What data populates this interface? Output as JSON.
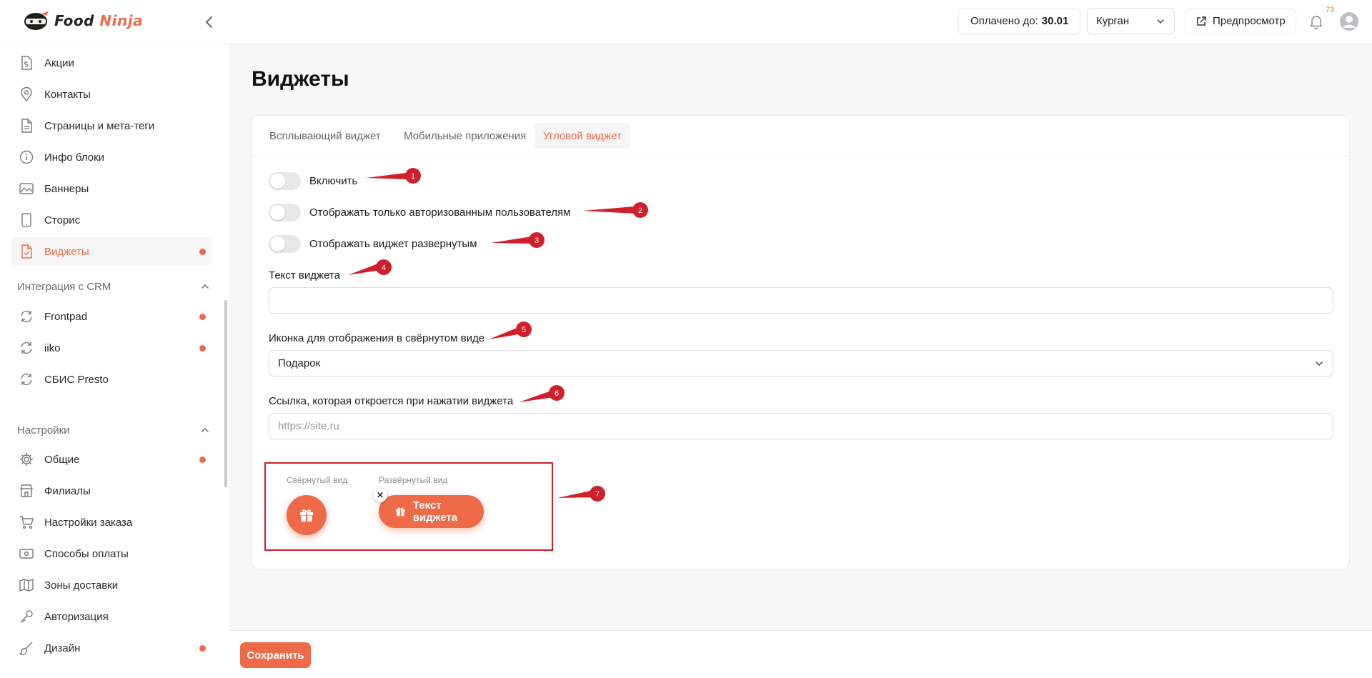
{
  "app": {
    "logo_word1": "Food",
    "logo_word2": "Ninja"
  },
  "header": {
    "paid_label": "Оплачено до:",
    "paid_date": "30.01",
    "city": "Курган",
    "preview_label": "Предпросмотр",
    "notification_count": "73"
  },
  "sidebar": {
    "items": [
      {
        "label": "Акции",
        "icon": "dollar-doc-icon",
        "dot": false,
        "active": false
      },
      {
        "label": "Контакты",
        "icon": "map-pin-icon",
        "dot": false,
        "active": false
      },
      {
        "label": "Страницы и мета-теги",
        "icon": "document-icon",
        "dot": false,
        "active": false
      },
      {
        "label": "Инфо блоки",
        "icon": "info-icon",
        "dot": false,
        "active": false
      },
      {
        "label": "Баннеры",
        "icon": "image-icon",
        "dot": false,
        "active": false
      },
      {
        "label": "Сторис",
        "icon": "phone-icon",
        "dot": false,
        "active": false
      },
      {
        "label": "Виджеты",
        "icon": "widget-doc-icon",
        "dot": true,
        "active": true
      }
    ],
    "crm_heading": "Интеграция с CRM",
    "crm_items": [
      {
        "label": "Frontpad",
        "icon": "sync-icon",
        "dot": true
      },
      {
        "label": "iiko",
        "icon": "sync-icon",
        "dot": true
      },
      {
        "label": "СБИС Presto",
        "icon": "sync-icon",
        "dot": false
      }
    ],
    "settings_heading": "Настройки",
    "settings_items": [
      {
        "label": "Общие",
        "icon": "gear-icon",
        "dot": true
      },
      {
        "label": "Филиалы",
        "icon": "store-icon",
        "dot": false
      },
      {
        "label": "Настройки заказа",
        "icon": "cart-icon",
        "dot": false
      },
      {
        "label": "Способы оплаты",
        "icon": "cash-icon",
        "dot": false
      },
      {
        "label": "Зоны доставки",
        "icon": "map-icon",
        "dot": false
      },
      {
        "label": "Авторизация",
        "icon": "key-icon",
        "dot": false
      },
      {
        "label": "Дизайн",
        "icon": "brush-icon",
        "dot": true
      }
    ]
  },
  "page": {
    "title": "Виджеты"
  },
  "tabs": [
    "Всплывающий виджет",
    "Мобильные приложения",
    "Угловой виджет"
  ],
  "form": {
    "toggle_enable": "Включить",
    "toggle_auth_only": "Отображать только авторизованным пользователям",
    "toggle_expanded": "Отображать виджет развернутым",
    "widget_text_label": "Текст виджета",
    "widget_text_value": "",
    "icon_label": "Иконка для отображения в свёрнутом виде",
    "icon_value": "Подарок",
    "link_label": "Ссылка, которая откроется при нажатии виджета",
    "link_placeholder": "https://site.ru"
  },
  "preview": {
    "collapsed_label": "Свёрнутый вид",
    "expanded_label": "Развёрнутый вид",
    "expanded_text": "Текст виджета"
  },
  "annotations": [
    "1",
    "2",
    "3",
    "4",
    "5",
    "6",
    "7"
  ],
  "footer": {
    "save_label": "Сохранить"
  },
  "colors": {
    "accent": "#ee6a49",
    "annotation": "#d01f2a"
  }
}
